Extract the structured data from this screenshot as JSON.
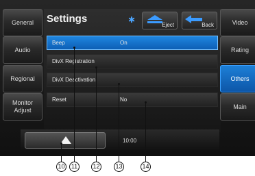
{
  "title": "Settings",
  "left_menu": [
    {
      "label": "General"
    },
    {
      "label": "Audio"
    },
    {
      "label": "Regional"
    },
    {
      "label": "Monitor Adjust"
    }
  ],
  "right_menu": [
    {
      "label": "Video"
    },
    {
      "label": "Rating"
    },
    {
      "label": "Others"
    },
    {
      "label": "Main"
    }
  ],
  "top_buttons": {
    "eject": "Eject",
    "back": "Back"
  },
  "rows": [
    {
      "label": "Beep",
      "value": "On"
    },
    {
      "label": "DivX Registration",
      "value": ""
    },
    {
      "label": "DivX Deactivation",
      "value": ""
    },
    {
      "label": "Reset",
      "value": "No"
    }
  ],
  "status": {
    "time": "10:00"
  },
  "callouts": [
    "10",
    "11",
    "12",
    "13",
    "14"
  ]
}
